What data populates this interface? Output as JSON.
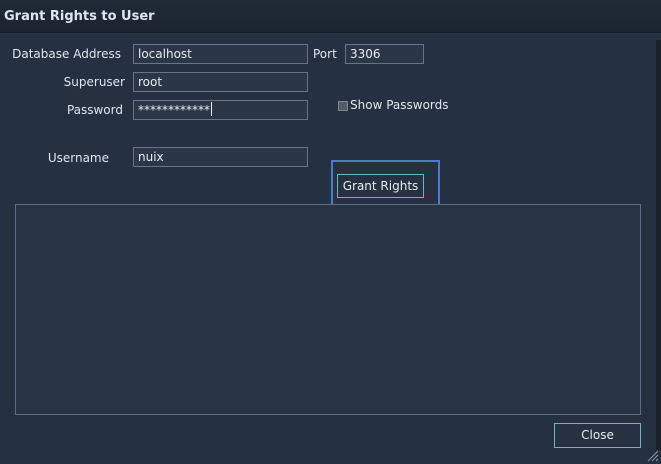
{
  "window": {
    "title": "Grant Rights to User"
  },
  "form": {
    "database_address_label": "Database Address",
    "database_address_value": "localhost",
    "port_label": "Port",
    "port_value": "3306",
    "superuser_label": "Superuser",
    "superuser_value": "root",
    "password_label": "Password",
    "password_value": "************",
    "show_passwords_label": "Show Passwords",
    "show_passwords_checked": false,
    "username_label": "Username",
    "username_value": "nuix"
  },
  "actions": {
    "grant_label": "Grant Rights",
    "close_label": "Close"
  },
  "output": {
    "text": ""
  },
  "icons": {
    "scroll_up": "chevron-up-icon",
    "scroll_down": "chevron-down-icon",
    "resize": "resize-grip-icon"
  },
  "colors": {
    "background": "#253040",
    "field_border": "#66758a",
    "button_border": "#6fb4c4",
    "highlight": "#4c7ad0"
  }
}
